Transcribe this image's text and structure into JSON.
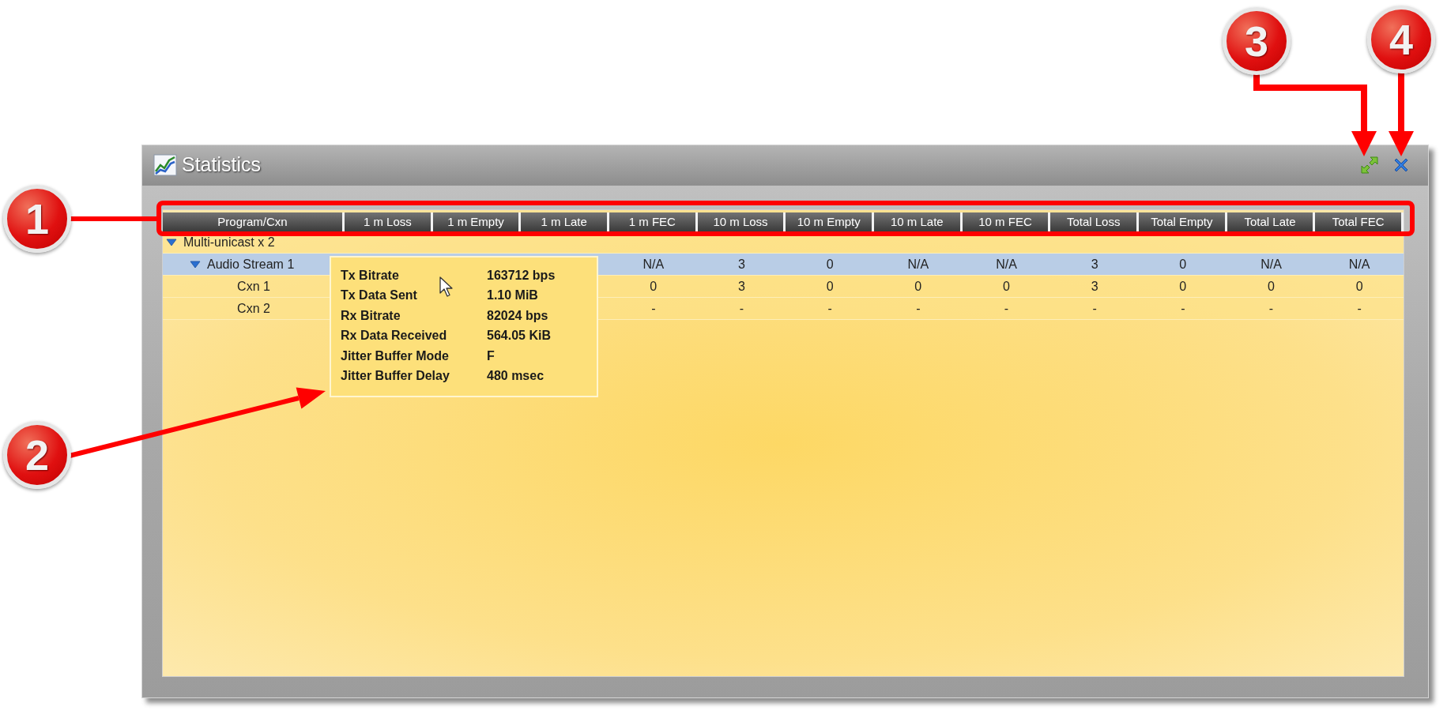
{
  "window": {
    "title": "Statistics"
  },
  "title_buttons": [
    {
      "kind": "expand"
    },
    {
      "kind": "close"
    }
  ],
  "table": {
    "columns": [
      "Program/Cxn",
      "1 m Loss",
      "1 m Empty",
      "1 m Late",
      "1 m FEC",
      "10 m Loss",
      "10 m Empty",
      "10 m Late",
      "10 m FEC",
      "Total Loss",
      "Total Empty",
      "Total Late",
      "Total FEC"
    ],
    "rows": [
      {
        "label": "Multi-unicast x 2",
        "expanded": true,
        "selected": false,
        "children": [
          {
            "label": "Audio Stream 1",
            "expanded": true,
            "selected": true,
            "cells": [
              "N/A",
              "3",
              "0",
              "N/A",
              "N/A",
              "3",
              "0",
              "N/A",
              "N/A"
            ],
            "children": [
              {
                "label": "Cxn 1",
                "selected": false,
                "cells": [
                  "0",
                  "3",
                  "0",
                  "0",
                  "0",
                  "3",
                  "0",
                  "0",
                  "0"
                ]
              },
              {
                "label": "Cxn 2",
                "selected": false,
                "cells": [
                  "-",
                  "-",
                  "-",
                  "-",
                  "-",
                  "-",
                  "-",
                  "-",
                  "-"
                ]
              }
            ]
          }
        ]
      }
    ]
  },
  "tooltip": {
    "rows": [
      {
        "label": "Tx Bitrate",
        "value": "163712 bps"
      },
      {
        "label": "Tx Data Sent",
        "value": "1.10 MiB"
      },
      {
        "label": "Rx Bitrate",
        "value": "82024 bps"
      },
      {
        "label": "Rx Data Received",
        "value": "564.05 KiB"
      },
      {
        "label": "Jitter Buffer Mode",
        "value": "F"
      },
      {
        "label": "Jitter Buffer Delay",
        "value": "480 msec"
      }
    ]
  },
  "callouts": [
    {
      "label": "1"
    },
    {
      "label": "2"
    },
    {
      "label": "3"
    },
    {
      "label": "4"
    }
  ]
}
